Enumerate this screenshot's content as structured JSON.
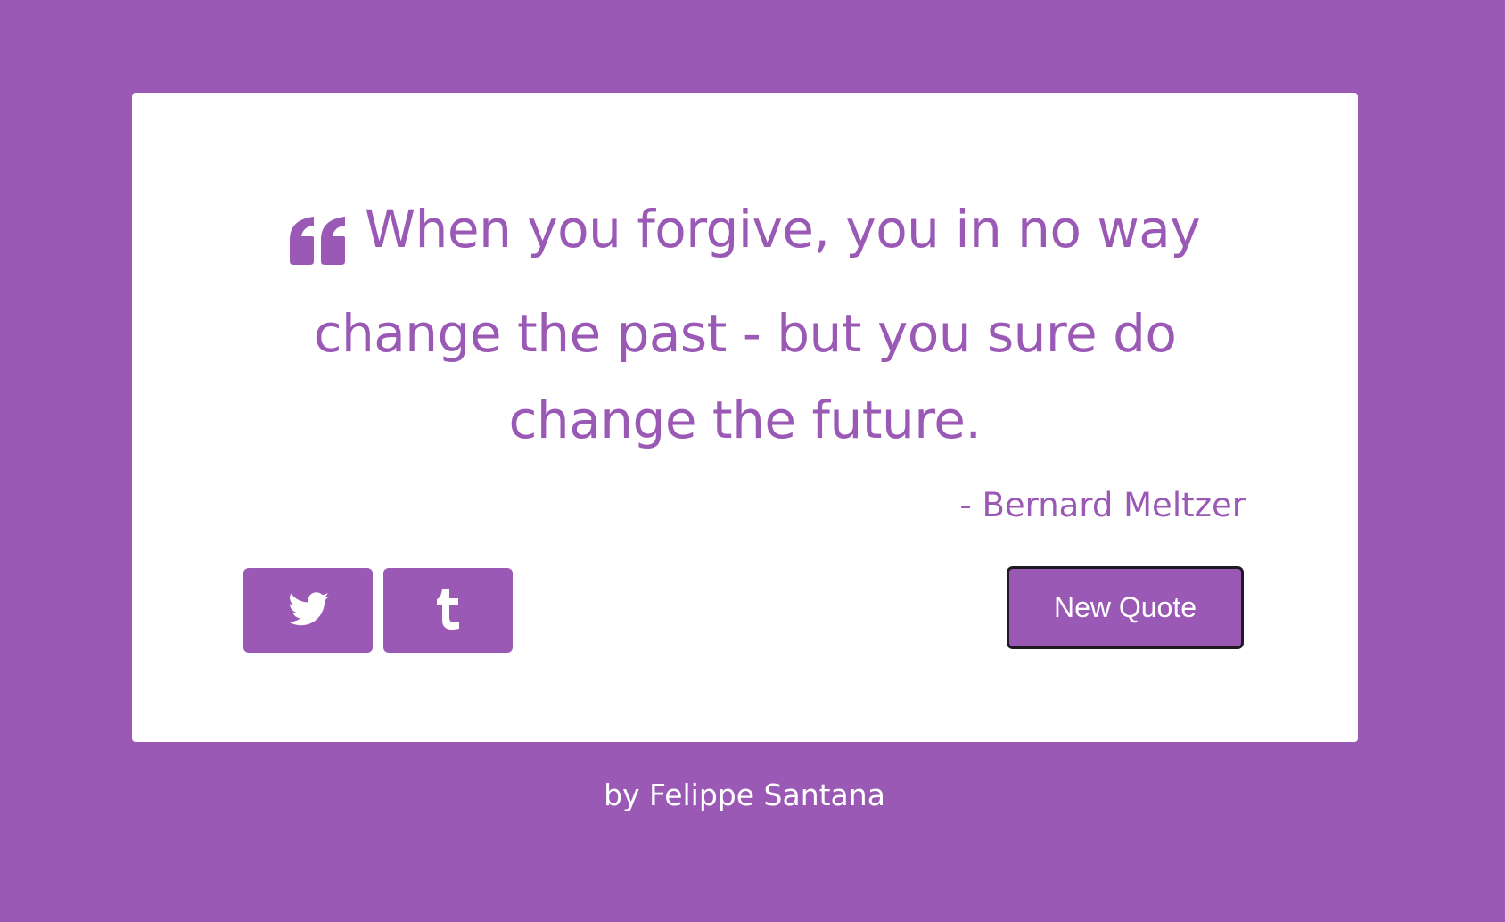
{
  "theme": {
    "background": "#9b59b6",
    "card_background": "#ffffff",
    "accent": "#9b59b6",
    "button_border": "#1f1a22"
  },
  "quote": {
    "icon": "quote-left-icon",
    "text": "When you forgive, you in no way change the past - but you sure do change the future.",
    "author": "- Bernard Meltzer"
  },
  "actions": {
    "tweet_icon": "twitter-icon",
    "tumblr_icon": "tumblr-icon",
    "new_quote_label": "New Quote"
  },
  "footer": {
    "credit": "by Felippe Santana"
  }
}
